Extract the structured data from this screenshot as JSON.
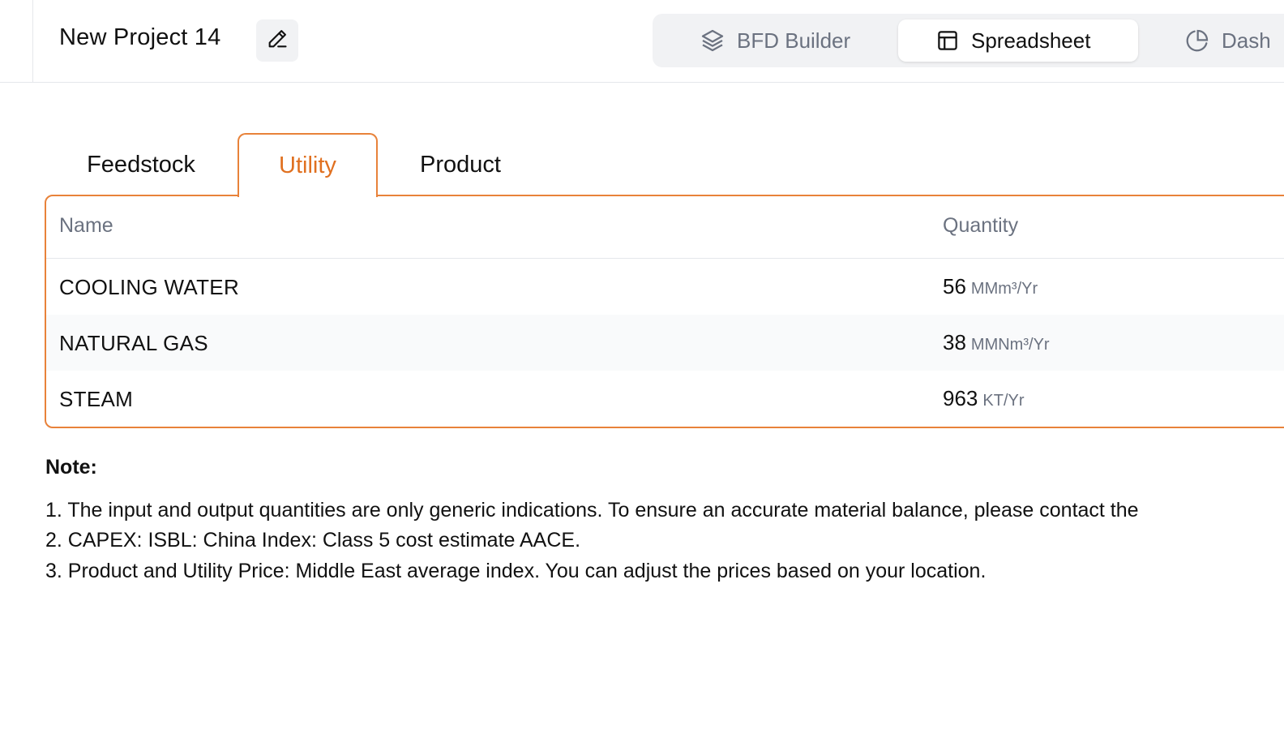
{
  "header": {
    "project_title": "New Project 14",
    "edit_icon": "pencil-icon",
    "views": [
      {
        "label": "BFD Builder",
        "icon": "layers-icon",
        "active": false
      },
      {
        "label": "Spreadsheet",
        "icon": "table-icon",
        "active": true
      },
      {
        "label": "Dash",
        "icon": "pie-chart-icon",
        "active": false
      }
    ]
  },
  "tabs": [
    {
      "label": "Feedstock",
      "active": false
    },
    {
      "label": "Utility",
      "active": true
    },
    {
      "label": "Product",
      "active": false
    }
  ],
  "table": {
    "columns": [
      "Name",
      "Quantity"
    ],
    "rows": [
      {
        "name": "COOLING WATER",
        "value": "56",
        "unit": "MMm³/Yr"
      },
      {
        "name": "NATURAL GAS",
        "value": "38",
        "unit": "MMNm³/Yr"
      },
      {
        "name": "STEAM",
        "value": "963",
        "unit": "KT/Yr"
      }
    ]
  },
  "notes": {
    "title": "Note:",
    "lines": [
      "1. The input and output quantities are only generic indications. To ensure an accurate material balance, please contact the",
      "2. CAPEX: ISBL: China Index: Class 5 cost estimate AACE.",
      "3. Product and Utility Price: Middle East average index. You can adjust the prices based on your location."
    ]
  },
  "colors": {
    "accent": "#e8823a",
    "accent_text": "#e07020",
    "muted_text": "#6b7280",
    "switch_bg": "#f1f2f4"
  }
}
